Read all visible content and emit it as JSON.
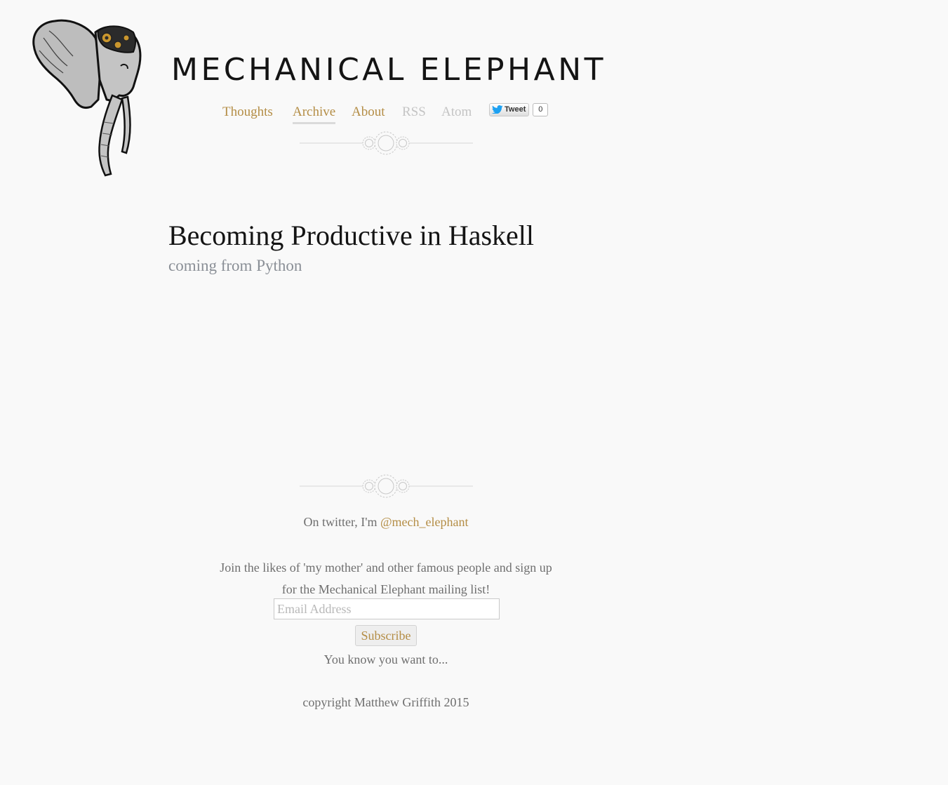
{
  "site": {
    "title": "MECHANICAL ELEPHANT"
  },
  "nav": {
    "items": [
      {
        "label": "Thoughts"
      },
      {
        "label": "Archive"
      },
      {
        "label": "About"
      },
      {
        "label": "RSS"
      },
      {
        "label": "Atom"
      }
    ],
    "active": "Archive",
    "link_color": "#b48d45",
    "muted_color": "#c4c4c4"
  },
  "tweet": {
    "label": "Tweet",
    "count": "0",
    "icon": "twitter-bird-icon"
  },
  "post": {
    "title": "Becoming Productive in Haskell",
    "subtitle": "coming from Python"
  },
  "footer": {
    "twitter_prefix": "On twitter, I'm ",
    "twitter_handle": "@mech_elephant",
    "signup_line1": "Join the likes of 'my mother' and other famous people and sign up",
    "signup_line2": "for the Mechanical Elephant mailing list!",
    "email_placeholder": "Email Address",
    "subscribe_label": "Subscribe",
    "tagline": "You know you want to...",
    "copyright": "copyright Matthew Griffith 2015"
  },
  "colors": {
    "background": "#f9f9f9",
    "accent": "#b48d45",
    "heading": "#141414",
    "subtitle": "#8a8f96"
  }
}
